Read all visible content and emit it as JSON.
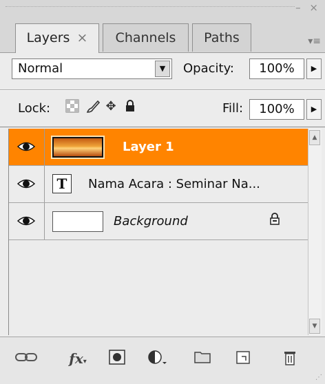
{
  "tabs": [
    {
      "label": "Layers",
      "close": "×"
    },
    {
      "label": "Channels"
    },
    {
      "label": "Paths"
    }
  ],
  "panel_controls": "– ×",
  "blend": {
    "mode": "Normal"
  },
  "opacity": {
    "label": "Opacity:",
    "value": "100%"
  },
  "lock": {
    "label": "Lock:"
  },
  "fill": {
    "label": "Fill:",
    "value": "100%"
  },
  "layers": [
    {
      "name": "Layer 1",
      "selected": true,
      "kind": "image"
    },
    {
      "name": "Nama Acara  : Seminar Na...",
      "kind": "text",
      "glyph": "T"
    },
    {
      "name": "Background",
      "kind": "background"
    }
  ],
  "footer": {
    "fx": "fx"
  },
  "colors": {
    "selection": "#ff8400",
    "panel": "#ececec"
  }
}
